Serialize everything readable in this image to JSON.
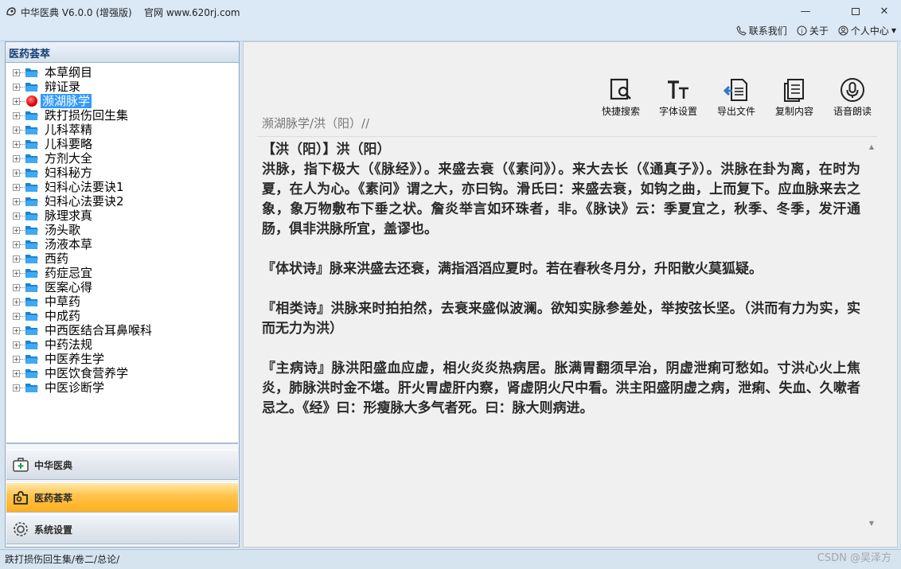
{
  "app": {
    "title": "中华医典 V6.0.0 (增强版)",
    "website": "官网 www.620rj.com",
    "menu": {
      "contact": "联系我们",
      "about": "关于",
      "user_center": "个人中心"
    }
  },
  "left": {
    "header": "医药荟萃",
    "tree": [
      {
        "label": "本草纲目",
        "selected": false
      },
      {
        "label": "辩证录",
        "selected": false
      },
      {
        "label": "濒湖脉学",
        "selected": true
      },
      {
        "label": "跌打损伤回生集",
        "selected": false
      },
      {
        "label": "儿科萃精",
        "selected": false
      },
      {
        "label": "儿科要略",
        "selected": false
      },
      {
        "label": "方剂大全",
        "selected": false
      },
      {
        "label": "妇科秘方",
        "selected": false
      },
      {
        "label": "妇科心法要诀1",
        "selected": false
      },
      {
        "label": "妇科心法要诀2",
        "selected": false
      },
      {
        "label": "脉理求真",
        "selected": false
      },
      {
        "label": "汤头歌",
        "selected": false
      },
      {
        "label": "汤液本草",
        "selected": false
      },
      {
        "label": "西药",
        "selected": false
      },
      {
        "label": "药症忌宜",
        "selected": false
      },
      {
        "label": "医案心得",
        "selected": false
      },
      {
        "label": "中草药",
        "selected": false
      },
      {
        "label": "中成药",
        "selected": false
      },
      {
        "label": "中西医结合耳鼻喉科",
        "selected": false
      },
      {
        "label": "中药法规",
        "selected": false
      },
      {
        "label": "中医养生学",
        "selected": false
      },
      {
        "label": "中医饮食营养学",
        "selected": false
      },
      {
        "label": "中医诊断学",
        "selected": false
      }
    ],
    "nav": [
      {
        "label": "中华医典",
        "active": false,
        "icon": "medical-kit-icon"
      },
      {
        "label": "医药荟萃",
        "active": true,
        "icon": "puzzle-icon"
      },
      {
        "label": "系统设置",
        "active": false,
        "icon": "gear-icon"
      }
    ]
  },
  "toolbar": {
    "quick_search": "快捷搜索",
    "font_settings": "字体设置",
    "export_file": "导出文件",
    "copy_content": "复制内容",
    "read_aloud": "语音朗读"
  },
  "content": {
    "breadcrumb": "濒湖脉学/洪（阳）//",
    "paragraphs": [
      "【洪（阳）】洪（阳）",
      "洪脉，指下极大（《脉经》）。来盛去衰（《素问》）。来大去长（《通真子》）。洪脉在卦为离，在时为夏，在人为心。《素问》谓之大，亦曰钩。滑氏曰：来盛去衰，如钩之曲，上而复下。应血脉来去之象，象万物敷布下垂之状。詹炎举言如环珠者，非。《脉诀》云：季夏宜之，秋季、冬季，发汗通肠，俱非洪脉所宜，盖谬也。",
      "『体状诗』脉来洪盛去还衰，满指滔滔应夏时。若在春秋冬月分，升阳散火莫狐疑。",
      "『相类诗』洪脉来时拍拍然，去衰来盛似波澜。欲知实脉参差处，举按弦长坚。（洪而有力为实，实而无力为洪）",
      "『主病诗』脉洪阳盛血应虚，相火炎炎热病居。胀满胃翻须早治，阴虚泄痢可愁如。寸洪心火上焦炎，肺脉洪时金不堪。肝火胃虚肝内察，肾虚阴火尺中看。洪主阳盛阴虚之病，泄痢、失血、久嗽者忌之。《经》曰：形瘦脉大多气者死。曰：脉大则病进。"
    ]
  },
  "status": {
    "path": "跌打损伤回生集/卷二/总论/"
  },
  "watermark": "CSDN @吴泽方"
}
